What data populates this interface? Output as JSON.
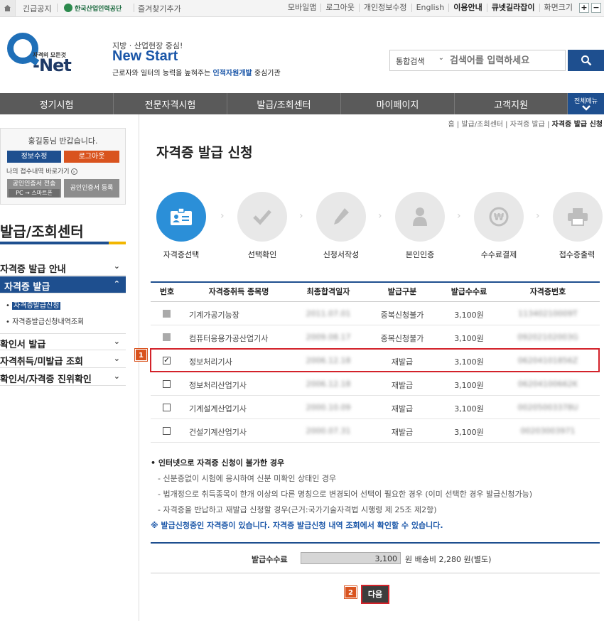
{
  "topbar": {
    "notice": "긴급공지",
    "org_logo_text": "한국산업인력공단",
    "favorites": "즐겨찾기추가",
    "links": [
      "모바일앱",
      "로그아웃",
      "개인정보수정",
      "English",
      "이용안내",
      "큐넷길라잡이",
      "화면크기"
    ],
    "zoom_in": "+",
    "zoom_out": "−"
  },
  "header": {
    "logo_sub": "자격의 모든것",
    "logo_main": "-Net",
    "slogan_small": "지방 · 산업현장 중심!",
    "slogan_big": "New Start",
    "slogan_desc_pre": "근로자와 일터의 능력을 높혀주는 ",
    "slogan_desc_hl": "인적자원개발",
    "slogan_desc_post": " 중심기관",
    "search_type": "통합검색",
    "search_placeholder": "검색어를 입력하세요"
  },
  "gnb": {
    "items": [
      "정기시험",
      "전문자격시험",
      "발급/조회센터",
      "마이페이지",
      "고객지원"
    ],
    "all_menu": "전체메뉴"
  },
  "login": {
    "greeting": "홍길동님 반갑습니다.",
    "edit_info": "정보수정",
    "logout": "로그아웃",
    "my_app_link": "나의 접수내역 바로가기",
    "cert_send_1": "공인인증서 전송",
    "cert_send_2": "PC → 스마트폰",
    "cert_register": "공인인증서 등록"
  },
  "sidebar": {
    "title": "발급/조회센터",
    "menu": [
      {
        "label": "자격증 발급 안내",
        "chev": "⌄"
      },
      {
        "label": "자격증 발급",
        "chev": "⌃"
      },
      {
        "label": "확인서 발급",
        "chev": "⌄"
      },
      {
        "label": "자격취득/미발급 조회",
        "chev": "⌄"
      },
      {
        "label": "확인서/자격증 진위확인",
        "chev": "⌄"
      }
    ],
    "sub": [
      "자격증발급신청",
      "자격증발급신청내역조회"
    ]
  },
  "main": {
    "breadcrumb_pre": "홈 | 발급/조회센터 | 자격증 발급 | ",
    "breadcrumb_cur": "자격증 발급 신청",
    "title": "자격증 발급 신청",
    "steps": [
      "자격증선택",
      "선택확인",
      "신청서작성",
      "본인인증",
      "수수료결제",
      "접수증출력"
    ],
    "arrow": "›",
    "columns": [
      "번호",
      "자격증취득 종목명",
      "최종합격일자",
      "발급구분",
      "발급수수료",
      "자격증번호"
    ],
    "rows": [
      {
        "name": "기계가공기능장",
        "date": "2011.07.01",
        "type": "중복신청불가",
        "fee": "3,100원",
        "cert_no": "11340210009T",
        "state": "disabled",
        "mark": ""
      },
      {
        "name": "컴퓨터응용가공산업기사",
        "date": "2009.08.17",
        "type": "중복신청불가",
        "fee": "3,100원",
        "cert_no": "09202102003G",
        "state": "disabled",
        "mark": ""
      },
      {
        "name": "정보처리기사",
        "date": "2006.12.18",
        "type": "재발급",
        "fee": "3,100원",
        "cert_no": "06204101856Z",
        "state": "checked",
        "mark": "✓"
      },
      {
        "name": "정보처리산업기사",
        "date": "2006.12.18",
        "type": "재발급",
        "fee": "3,100원",
        "cert_no": "06204100662K",
        "state": "unchecked",
        "mark": ""
      },
      {
        "name": "기계설계산업기사",
        "date": "2000.10.09",
        "type": "재발급",
        "fee": "3,100원",
        "cert_no": "00205003378U",
        "state": "unchecked",
        "mark": ""
      },
      {
        "name": "건설기계산업기사",
        "date": "2000.07.31",
        "type": "재발급",
        "fee": "3,100원",
        "cert_no": "00203003971",
        "state": "unchecked",
        "mark": ""
      }
    ],
    "marker_1": "1",
    "marker_2": "2",
    "note_head": "• 인터넷으로 자격증 신청이 불가한 경우",
    "notes": [
      "- 신분증없이 시험에 응시하여 신분 미확인 상태인 경우",
      "- 법개정으로 취득종목이 한개 이상의 다른 명칭으로 변경되어 선택이 필요한 경우 (이미 선택한 경우 발급신청가능)",
      "- 자격증을 반납하고 재발급 신청할 경우(근거:국가기술자격법 시행령 제 25조 제2항)"
    ],
    "note_blue": "※ 발급신청중인 자격증이 있습니다. 자격증 발급신청 내역 조회에서 확인할 수 있습니다.",
    "fee_label": "발급수수료",
    "fee_value": "3,100",
    "fee_unit": "원   배송비 2,280 원(별도)",
    "next": "다음"
  },
  "colors": {
    "navy": "#1e4f8f",
    "orange": "#d9531e",
    "highlight": "#d3222a",
    "step_on": "#2b8fd8"
  }
}
